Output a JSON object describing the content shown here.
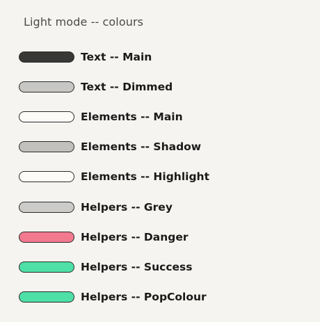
{
  "title": "Light mode -- colours",
  "swatches": [
    {
      "label": "Text -- Main",
      "color": "#383836"
    },
    {
      "label": "Text -- Dimmed",
      "color": "#c7c7c5"
    },
    {
      "label": "Elements -- Main",
      "color": "#fcfbf8"
    },
    {
      "label": "Elements -- Shadow",
      "color": "#c2c0bc"
    },
    {
      "label": "Elements -- Highlight",
      "color": "#fcfbf8"
    },
    {
      "label": "Helpers -- Grey",
      "color": "#cbcbc9"
    },
    {
      "label": "Helpers -- Danger",
      "color": "#f3798e"
    },
    {
      "label": "Helpers -- Success",
      "color": "#4ee0a6"
    },
    {
      "label": "Helpers -- PopColour",
      "color": "#4ee0a6"
    }
  ]
}
